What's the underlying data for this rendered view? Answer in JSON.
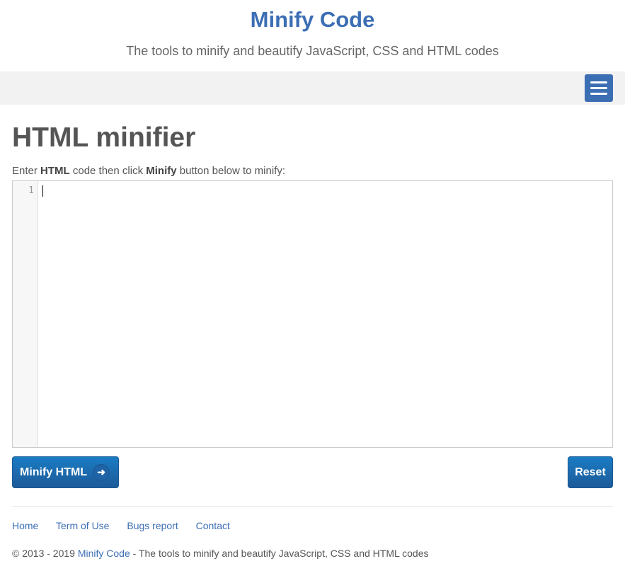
{
  "header": {
    "title": "Minify Code",
    "tagline": "The tools to minify and beautify JavaScript, CSS and HTML codes"
  },
  "nav": {
    "menu_icon": "hamburger-icon"
  },
  "main": {
    "page_title": "HTML minifier",
    "instructions": {
      "part1": "Enter ",
      "bold1": "HTML",
      "part2": " code then click ",
      "bold2": "Minify",
      "part3": " button below to minify:"
    },
    "editor": {
      "line_number": "1",
      "content": ""
    },
    "minify_button": {
      "label": "Minify HTML",
      "icon": "arrow-right-icon"
    },
    "reset_button": {
      "label": "Reset"
    }
  },
  "footer": {
    "links": [
      "Home",
      "Term of Use",
      "Bugs report",
      "Contact"
    ],
    "copyright_prefix": "© 2013 - 2019 ",
    "copyright_link": "Minify Code",
    "copyright_suffix": " - The tools to minify and beautify JavaScript, CSS and HTML codes"
  },
  "colors": {
    "brand": "#3c6eb4",
    "button": "#1d6bb0",
    "nav_bg": "#f2f2f2"
  }
}
